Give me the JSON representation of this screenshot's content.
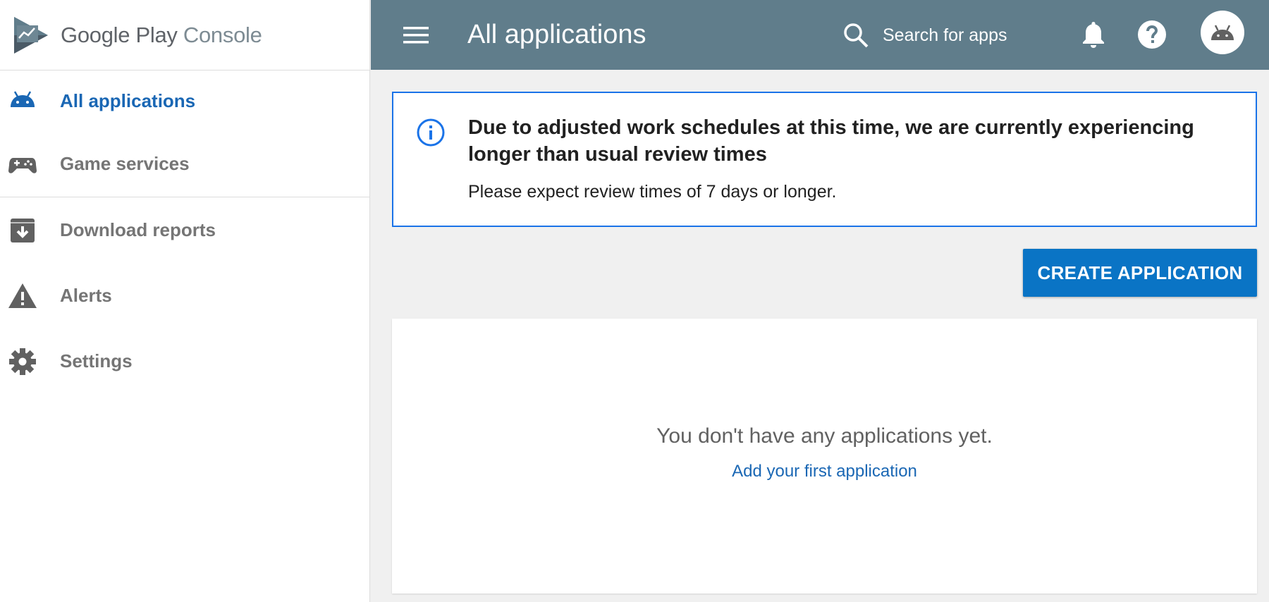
{
  "brand": {
    "name_main": "Google Play",
    "name_sub": " Console",
    "logo_icon": "play-console-logo"
  },
  "sidebar": {
    "items": [
      {
        "label": "All applications",
        "icon": "android-icon",
        "active": true
      },
      {
        "label": "Game services",
        "icon": "gamepad-icon",
        "active": false
      },
      {
        "label": "Download reports",
        "icon": "download-box-icon",
        "active": false
      },
      {
        "label": "Alerts",
        "icon": "warning-icon",
        "active": false
      },
      {
        "label": "Settings",
        "icon": "gear-icon",
        "active": false
      }
    ]
  },
  "header": {
    "title": "All applications",
    "search_placeholder": "Search for apps",
    "icons": [
      "menu-icon",
      "search-icon",
      "bell-icon",
      "help-icon",
      "avatar-android-icon"
    ]
  },
  "notice": {
    "title": "Due to adjusted work schedules at this time, we are currently experiencing longer than usual review times",
    "body": "Please expect review times of 7 days or longer.",
    "icon": "info-icon"
  },
  "actions": {
    "create_label": "CREATE APPLICATION"
  },
  "empty_state": {
    "message": "You don't have any applications yet.",
    "link": "Add your first application"
  },
  "colors": {
    "topbar": "#607d8b",
    "accent": "#0a74c5",
    "active_nav": "#1a67b4",
    "notice_border": "#1a73e8"
  }
}
